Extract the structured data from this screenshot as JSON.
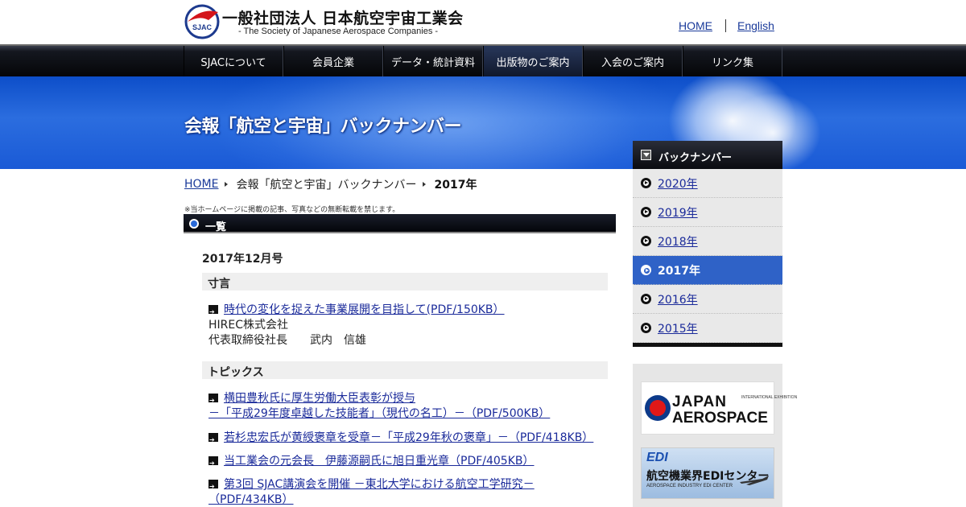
{
  "header": {
    "logo_text": "SJAC",
    "org_name": "一般社団法人 日本航空宇宙工業会",
    "org_sub": "- The Society of Japanese Aerospace Companies -",
    "links": [
      "HOME",
      "English"
    ]
  },
  "nav": [
    "SJACについて",
    "会員企業",
    "データ・統計資料",
    "出版物のご案内",
    "入会のご案内",
    "リンク集"
  ],
  "nav_active_index": 3,
  "hero": {
    "title": "会報「航空と宇宙」バックナンバー"
  },
  "breadcrumb": {
    "home": "HOME",
    "parent": "会報「航空と宇宙」バックナンバー",
    "current": "2017年"
  },
  "notice": "※当ホームページに掲載の記事、写真などの無断転載を禁じます。",
  "section": {
    "title": "一覧"
  },
  "issue": {
    "title": "2017年12月号",
    "categories": [
      {
        "name": "寸言",
        "articles": [
          {
            "link": "時代の変化を捉えた事業展開を目指して(PDF/150KB）",
            "lines": [
              "HIREC株式会社",
              "代表取締役社長　　武内　信雄"
            ]
          }
        ]
      },
      {
        "name": "トピックス",
        "articles": [
          {
            "link": "横田豊秋氏に厚生労働大臣表彰が授与",
            "link2": "－「平成29年度卓越した技能者」（現代の名工）－（PDF/500KB）"
          },
          {
            "link": "若杉忠宏氏が黄綬褒章を受章－「平成29年秋の褒章」－（PDF/418KB）"
          },
          {
            "link": "当工業会の元会長　伊藤源嗣氏に旭日重光章（PDF/405KB）"
          },
          {
            "link": "第3回 SJAC講演会を開催 －東北大学における航空工学研究－",
            "link2": "（PDF/434KB）"
          }
        ]
      }
    ]
  },
  "sidebar": {
    "title": "バックナンバー",
    "years": [
      "2020年",
      "2019年",
      "2018年",
      "2017年",
      "2016年",
      "2015年"
    ],
    "active_year": "2017年"
  },
  "banners": {
    "japan_aerospace": {
      "line1": "JAPAN",
      "line2": "AEROSPACE",
      "tag": "INTERNATIONAL EXHIBITION"
    },
    "edi": {
      "logo": "EDI",
      "title": "航空機業界EDIセンター",
      "sub": "AEROSPACE INDUSTRY EDI CENTER"
    }
  },
  "colors": {
    "nav_bg": "#05060a",
    "hero_blue": "#1a5ad6",
    "active_item": "#2f62c7",
    "link": "#1a2a9a"
  }
}
